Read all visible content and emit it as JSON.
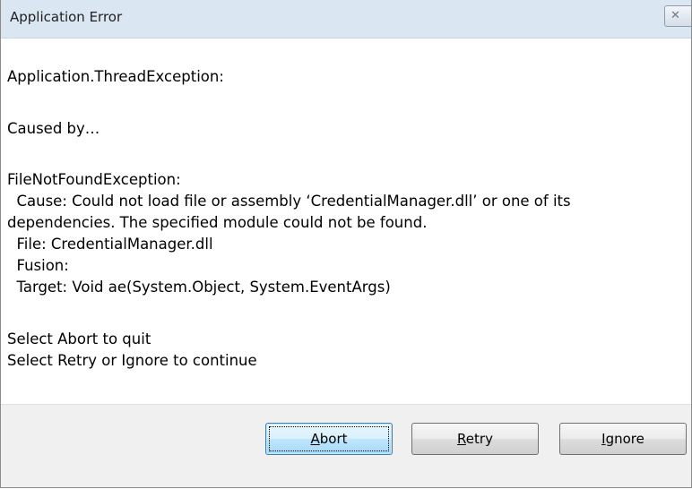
{
  "window": {
    "title": "Application Error",
    "close_glyph": "✕",
    "close_icon": "close-icon"
  },
  "message": {
    "lines": [
      "Application.ThreadException:",
      "Caused by…",
      "FileNotFoundException:",
      "  Cause: Could not load file or assembly ‘CredentialManager.dll’ or one of its",
      "dependencies. The specified module could not be found.",
      "  File: CredentialManager.dll",
      "  Fusion:",
      "  Target: Void ae(System.Object, System.EventArgs)",
      "Select Abort to quit",
      "Select Retry or Ignore to continue"
    ]
  },
  "buttons": {
    "abort": {
      "accel": "A",
      "rest": "bort"
    },
    "retry": {
      "accel": "R",
      "rest": "etry"
    },
    "ignore": {
      "accel": "I",
      "rest": "gnore"
    }
  }
}
